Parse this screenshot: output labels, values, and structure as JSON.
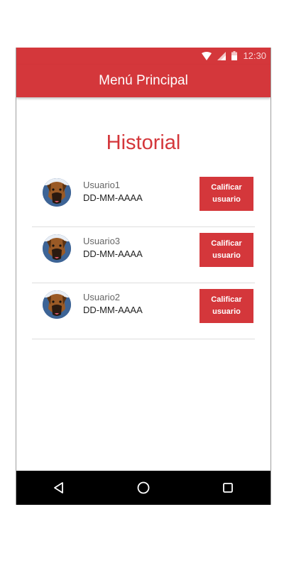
{
  "status_bar": {
    "time": "12:30",
    "icons": [
      "wifi-icon",
      "signal-icon",
      "battery-icon"
    ]
  },
  "app_bar": {
    "title": "Menú Principal"
  },
  "section": {
    "title": "Historial"
  },
  "history": [
    {
      "user": "Usuario1",
      "date": "DD-MM-AAAA",
      "button": "Calificar usuario"
    },
    {
      "user": "Usuario3",
      "date": "DD-MM-AAAA",
      "button": "Calificar usuario"
    },
    {
      "user": "Usuario2",
      "date": "DD-MM-AAAA",
      "button": "Calificar usuario"
    }
  ],
  "nav_bar": {
    "icons": [
      "back-icon",
      "home-icon",
      "recents-icon"
    ]
  },
  "colors": {
    "primary": "#d4373b",
    "nav_background": "#000000"
  }
}
